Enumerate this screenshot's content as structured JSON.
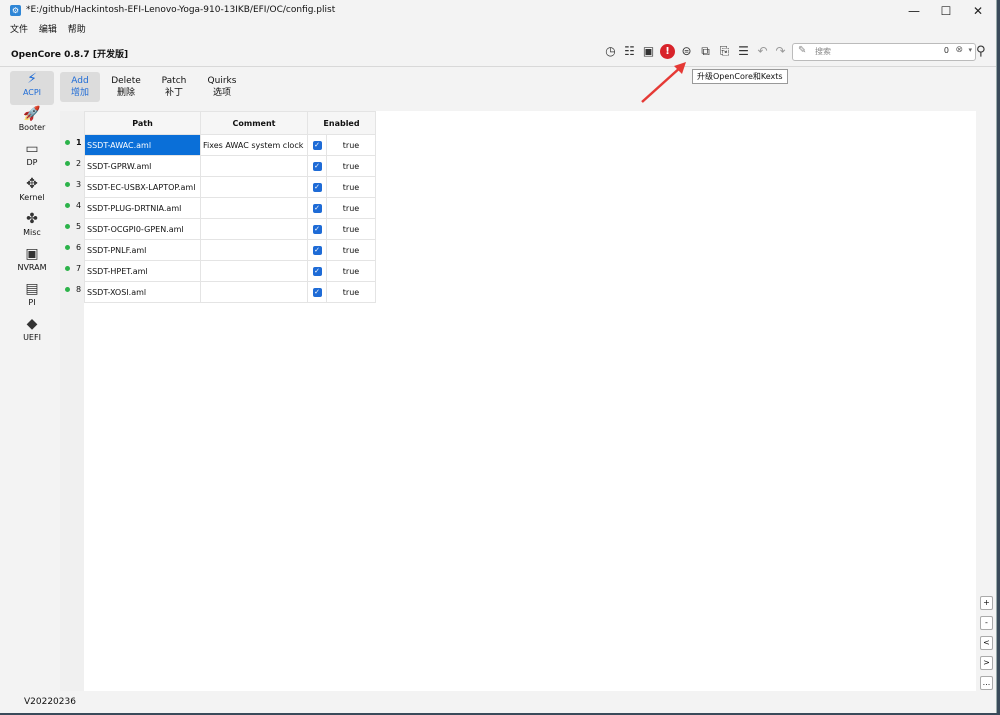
{
  "window": {
    "title": "*E:/github/Hackintosh-EFI-Lenovo-Yoga-910-13IKB/EFI/OC/config.plist"
  },
  "menu": [
    "文件",
    "编辑",
    "帮助"
  ],
  "product": "OpenCore 0.8.7 [开发版]",
  "search": {
    "placeholder": "搜索",
    "count": "0"
  },
  "tooltip": "升级OpenCore和Kexts",
  "sidebar": [
    {
      "label": "ACPI",
      "icon": "lightning-icon",
      "glyph": "⚡",
      "active": true
    },
    {
      "label": "Booter",
      "icon": "rocket-icon",
      "glyph": "🚀"
    },
    {
      "label": "DP",
      "icon": "gpu-icon",
      "glyph": "▭"
    },
    {
      "label": "Kernel",
      "icon": "kernel-icon",
      "glyph": "✥"
    },
    {
      "label": "Misc",
      "icon": "misc-icon",
      "glyph": "✤"
    },
    {
      "label": "NVRAM",
      "icon": "chip-icon",
      "glyph": "▣"
    },
    {
      "label": "PI",
      "icon": "monitor-icon",
      "glyph": "▤"
    },
    {
      "label": "UEFI",
      "icon": "cube-icon",
      "glyph": "◆"
    }
  ],
  "subtabs": [
    {
      "en": "Add",
      "zh": "增加",
      "active": true
    },
    {
      "en": "Delete",
      "zh": "删除"
    },
    {
      "en": "Patch",
      "zh": "补丁"
    },
    {
      "en": "Quirks",
      "zh": "选项"
    }
  ],
  "table": {
    "headers": [
      "Path",
      "Comment",
      "Enabled"
    ],
    "rows": [
      {
        "n": "1",
        "path": "SSDT-AWAC.aml",
        "comment": "Fixes AWAC system clock",
        "enabled": "true"
      },
      {
        "n": "2",
        "path": "SSDT-GPRW.aml",
        "comment": "",
        "enabled": "true"
      },
      {
        "n": "3",
        "path": "SSDT-EC-USBX-LAPTOP.aml",
        "comment": "",
        "enabled": "true"
      },
      {
        "n": "4",
        "path": "SSDT-PLUG-DRTNIA.aml",
        "comment": "",
        "enabled": "true"
      },
      {
        "n": "5",
        "path": "SSDT-OCGPI0-GPEN.aml",
        "comment": "",
        "enabled": "true"
      },
      {
        "n": "6",
        "path": "SSDT-PNLF.aml",
        "comment": "",
        "enabled": "true"
      },
      {
        "n": "7",
        "path": "SSDT-HPET.aml",
        "comment": "",
        "enabled": "true"
      },
      {
        "n": "8",
        "path": "SSDT-XOSI.aml",
        "comment": "",
        "enabled": "true"
      }
    ]
  },
  "right_buttons": [
    "+",
    "-",
    "<",
    ">",
    "..."
  ],
  "status": "V20220236"
}
